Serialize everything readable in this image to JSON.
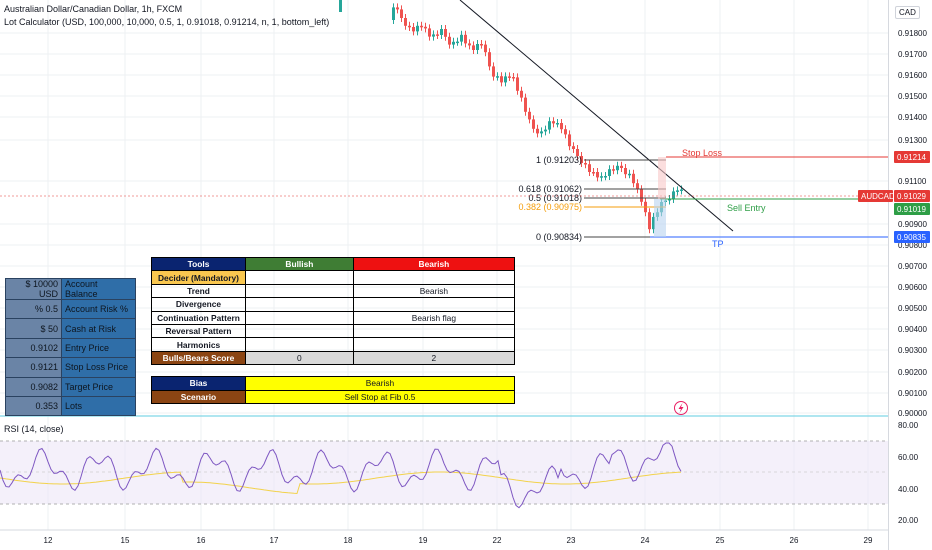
{
  "header": {
    "symbol": "Australian Dollar/Canadian Dollar, 1h, FXCM",
    "indicator": "Lot Calculator (USD, 100,000, 10,000, 0.5, 1, 0.91018, 0.91214, n, 1, bottom_left)",
    "currency": "CAD"
  },
  "price_axis": {
    "ticks": [
      "0.91800",
      "0.91700",
      "0.91600",
      "0.91500",
      "0.91400",
      "0.91300",
      "0.91100",
      "0.90900",
      "0.90800",
      "0.90700",
      "0.90600",
      "0.90500",
      "0.90400",
      "0.90300",
      "0.90200",
      "0.90100",
      "0.90000"
    ],
    "stop_tag": "0.91214",
    "symbol_tag": "AUDCAD",
    "last_tag": "0.91029",
    "entry_tag": "0.91019",
    "tp_tag": "0.90835",
    "colors": {
      "stop": "#e53935",
      "last": "#e53935",
      "entry": "#2e9e46",
      "tp": "#2962ff"
    }
  },
  "fib": {
    "l1": "1 (0.91203)",
    "l0618": "0.618 (0.91062)",
    "l05": "0.5 (0.91018)",
    "l0382": "0.382 (0.90975)",
    "l0": "0 (0.90834)"
  },
  "annotations": {
    "stop_loss": "Stop Loss",
    "sell_entry": "Sell Entry",
    "tp": "TP"
  },
  "rsi": {
    "title": "RSI (14, close)",
    "ticks": [
      "80.00",
      "60.00",
      "40.00",
      "20.00"
    ]
  },
  "time_axis": [
    "12",
    "15",
    "16",
    "17",
    "18",
    "19",
    "22",
    "23",
    "24",
    "25",
    "26",
    "29"
  ],
  "lot_calc": [
    {
      "value": "$ 10000 USD",
      "label": "Account Balance"
    },
    {
      "value": "% 0.5",
      "label": "Account Risk %"
    },
    {
      "value": "$ 50",
      "label": "Cash at Risk"
    },
    {
      "value": "0.9102",
      "label": "Entry Price"
    },
    {
      "value": "0.9121",
      "label": "Stop Loss Price"
    },
    {
      "value": "0.9082",
      "label": "Target Price"
    },
    {
      "value": "0.353",
      "label": "Lots"
    }
  ],
  "tools_table": {
    "header": {
      "tools": "Tools",
      "bullish": "Bullish",
      "bearish": "Bearish"
    },
    "rows": [
      {
        "label": "Decider (Mandatory)",
        "bullish": "",
        "bearish": ""
      },
      {
        "label": "Trend",
        "bullish": "",
        "bearish": "Bearish"
      },
      {
        "label": "Divergence",
        "bullish": "",
        "bearish": ""
      },
      {
        "label": "Continuation Pattern",
        "bullish": "",
        "bearish": "Bearish flag"
      },
      {
        "label": "Reversal Pattern",
        "bullish": "",
        "bearish": ""
      },
      {
        "label": "Harmonics",
        "bullish": "",
        "bearish": ""
      },
      {
        "label": "Bulls/Bears Score",
        "bullish": "0",
        "bearish": "2"
      }
    ],
    "bias": {
      "label": "Bias",
      "value": "Bearish"
    },
    "scenario": {
      "label": "Scenario",
      "value": "Sell Stop at Fib 0.5"
    }
  }
}
